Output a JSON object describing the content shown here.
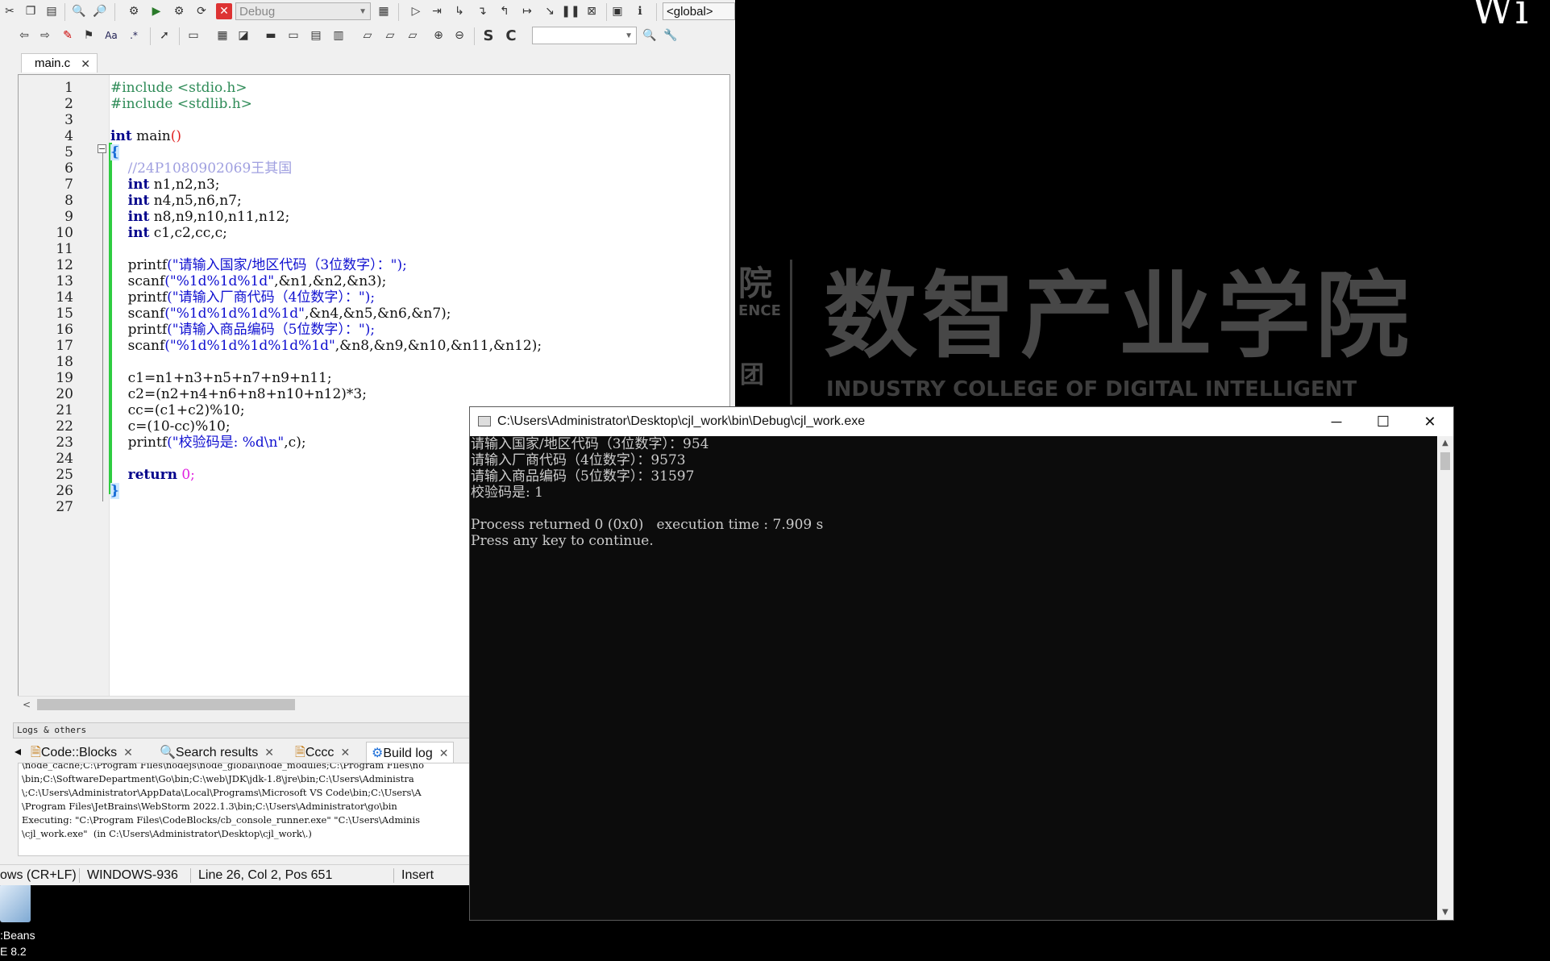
{
  "wallpaper": {
    "corner_text": "Wi",
    "partial_chars": [
      "院",
      "ENCE",
      "团"
    ],
    "college_name": "数智产业学院",
    "college_english": "INDUSTRY COLLEGE OF  DIGITAL INTELLIGENT"
  },
  "desktop_icon": {
    "label_line1": ":Beans",
    "label_line2": "E 8.2"
  },
  "codeblocks": {
    "toolbar": {
      "build_target": "Debug",
      "scope": "<global>"
    },
    "editor_tab": {
      "label": "main.c"
    },
    "lines": [
      {
        "n": "1"
      },
      {
        "n": "2"
      },
      {
        "n": "3"
      },
      {
        "n": "4"
      },
      {
        "n": "5"
      },
      {
        "n": "6"
      },
      {
        "n": "7"
      },
      {
        "n": "8"
      },
      {
        "n": "9"
      },
      {
        "n": "10"
      },
      {
        "n": "11"
      },
      {
        "n": "12"
      },
      {
        "n": "13"
      },
      {
        "n": "14"
      },
      {
        "n": "15"
      },
      {
        "n": "16"
      },
      {
        "n": "17"
      },
      {
        "n": "18"
      },
      {
        "n": "19"
      },
      {
        "n": "20"
      },
      {
        "n": "21"
      },
      {
        "n": "22"
      },
      {
        "n": "23"
      },
      {
        "n": "24"
      },
      {
        "n": "25"
      },
      {
        "n": "26"
      },
      {
        "n": "27"
      }
    ],
    "code": {
      "l1": "#include <stdio.h>",
      "l2": "#include <stdlib.h>",
      "l4_kw": "int",
      "l4_rest": " main",
      "l4_par": "()",
      "l5": "{",
      "l6": "    //24P1080902069王其国",
      "l7_kw": "int",
      "l7_rest": " n1,n2,n3;",
      "l8_kw": "int",
      "l8_rest": " n4,n5,n6,n7;",
      "l9_kw": "int",
      "l9_rest": " n8,n9,n10,n11,n12;",
      "l10_kw": "int",
      "l10_rest": " c1,c2,cc,c;",
      "l12_fn": "    printf",
      "l12_str": "(\"请输入国家/地区代码（3位数字）：\");",
      "l13_fn": "    scanf",
      "l13_str": "(\"%1d%1d%1d\"",
      "l13_rest": ",&n1,&n2,&n3);",
      "l14_fn": "    printf",
      "l14_str": "(\"请输入厂商代码（4位数字）：\");",
      "l15_fn": "    scanf",
      "l15_str": "(\"%1d%1d%1d%1d\"",
      "l15_rest": ",&n4,&n5,&n6,&n7);",
      "l16_fn": "    printf",
      "l16_str": "(\"请输入商品编码（5位数字）：\");",
      "l17_fn": "    scanf",
      "l17_str": "(\"%1d%1d%1d%1d%1d\"",
      "l17_rest": ",&n8,&n9,&n10,&n11,&n12);",
      "l19": "    c1=n1+n3+n5+n7+n9+n11;",
      "l20": "    c2=(n2+n4+n6+n8+n10+n12)*3;",
      "l21": "    cc=(c1+c2)%10;",
      "l22": "    c=(10-cc)%10;",
      "l23_fn": "    printf",
      "l23_str": "(\"校验码是: %d\\n\"",
      "l23_rest": ",c);",
      "l25_kw": "return",
      "l25_rest": " 0;",
      "l26": "}"
    },
    "logs": {
      "title": "Logs & others",
      "tabs": [
        "Code::Blocks",
        "Search results",
        "Cccc",
        "Build log"
      ],
      "lines": [
        "\\node_cache;C:\\Program Files\\nodejs\\node_global\\node_modules;C:\\Program Files\\no",
        "\\bin;C:\\SoftwareDepartment\\Go\\bin;C:\\web\\JDK\\jdk-1.8\\jre\\bin;C:\\Users\\Administra",
        "\\;C:\\Users\\Administrator\\AppData\\Local\\Programs\\Microsoft VS Code\\bin;C:\\Users\\A",
        "\\Program Files\\JetBrains\\WebStorm 2022.1.3\\bin;C:\\Users\\Administrator\\go\\bin",
        "Executing: \"C:\\Program Files\\CodeBlocks/cb_console_runner.exe\" \"C:\\Users\\Adminis",
        "\\cjl_work.exe\"  (in C:\\Users\\Administrator\\Desktop\\cjl_work\\.)"
      ]
    },
    "status": {
      "eol": "ows (CR+LF)",
      "encoding": "WINDOWS-936",
      "position": "Line 26, Col 2, Pos 651",
      "mode": "Insert"
    }
  },
  "console": {
    "title": "C:\\Users\\Administrator\\Desktop\\cjl_work\\bin\\Debug\\cjl_work.exe",
    "lines": [
      "请输入国家/地区代码（3位数字）：954",
      "请输入厂商代码（4位数字）：9573",
      "请输入商品编码（5位数字）：31597",
      "校验码是: 1",
      "",
      "Process returned 0 (0x0)   execution time : 7.909 s",
      "Press any key to continue."
    ]
  }
}
